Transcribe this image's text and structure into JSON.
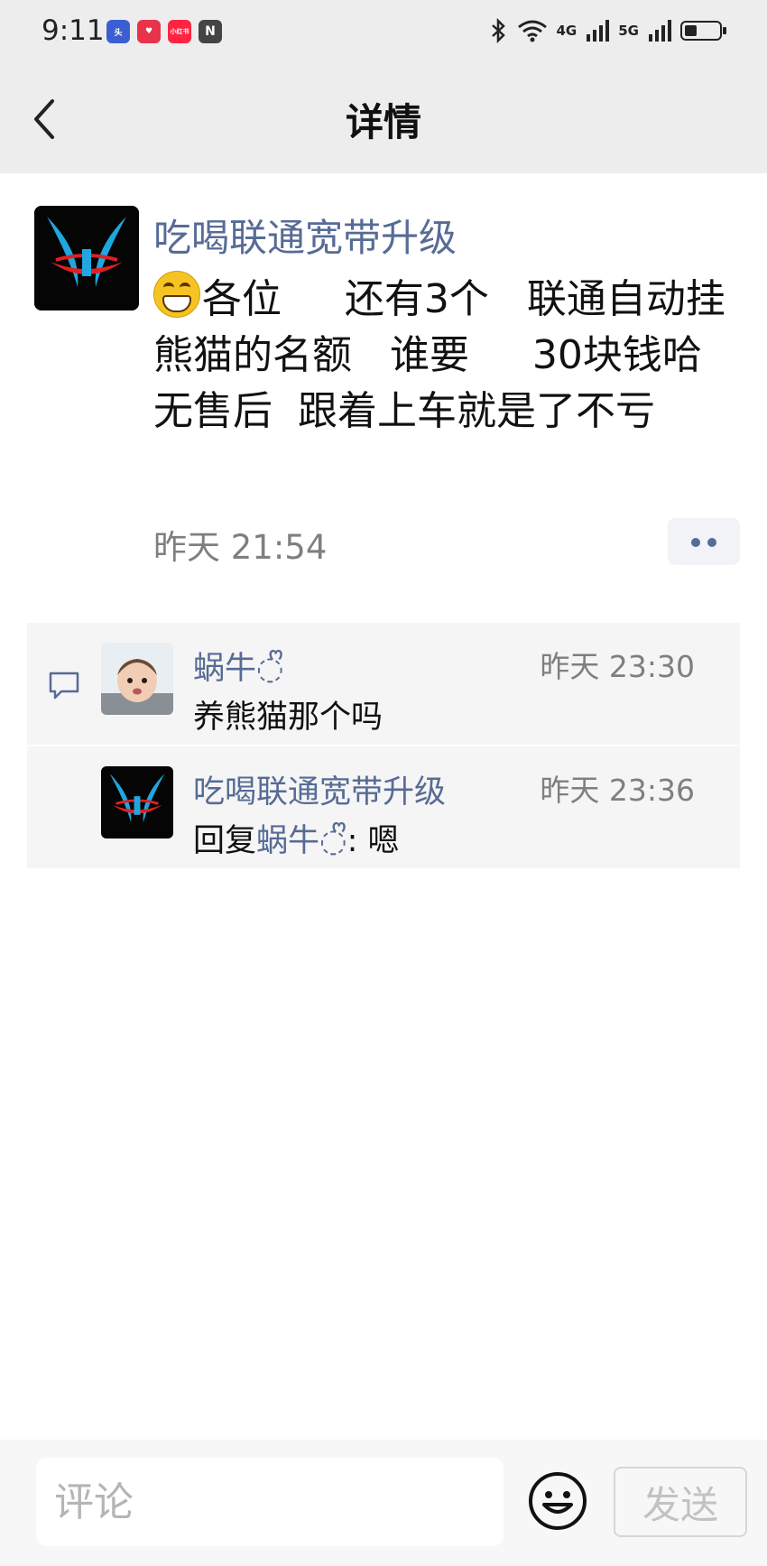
{
  "status_bar": {
    "time": "9:11",
    "app_icons": [
      {
        "name": "news-app-icon",
        "label": "头",
        "color": "#3b5fd0"
      },
      {
        "name": "heart-app-icon",
        "label": "♥",
        "color": "#e8334a"
      },
      {
        "name": "shop-app-icon",
        "label": "小红书",
        "color": "#ff2442"
      },
      {
        "name": "nfc-icon",
        "label": "N",
        "color": "#444444"
      }
    ],
    "network_1": "4G",
    "network_2": "5G",
    "battery_level": 0.35
  },
  "nav": {
    "title": "详情",
    "back_icon": "chevron-left-icon"
  },
  "post": {
    "author": "吃喝联通宽带升级",
    "text": "各位     还有3个   联通自动挂熊猫的名额   谁要     30块钱哈       无售后  跟着上车就是了不亏",
    "emoji": "grinning-face",
    "time": "昨天 21:54",
    "more_icon": "more-dots-icon"
  },
  "comments": [
    {
      "author": "蜗牛◌ᩚ",
      "time": "昨天 23:30",
      "text": "养熊猫那个吗",
      "avatar": "baby-photo-avatar"
    },
    {
      "author": "吃喝联通宽带升级",
      "time": "昨天 23:36",
      "reply_prefix": "回复",
      "reply_to": "蜗牛◌ᩚ",
      "reply_sep": ": ",
      "text": "嗯",
      "avatar": "logo-avatar"
    }
  ],
  "composer": {
    "placeholder": "评论",
    "send_label": "发送",
    "emoji_icon": "smiley-icon"
  },
  "colors": {
    "link": "#576b95",
    "header_bg": "#ededed",
    "comment_bg": "#f5f5f5",
    "muted": "#7f7f7f"
  }
}
